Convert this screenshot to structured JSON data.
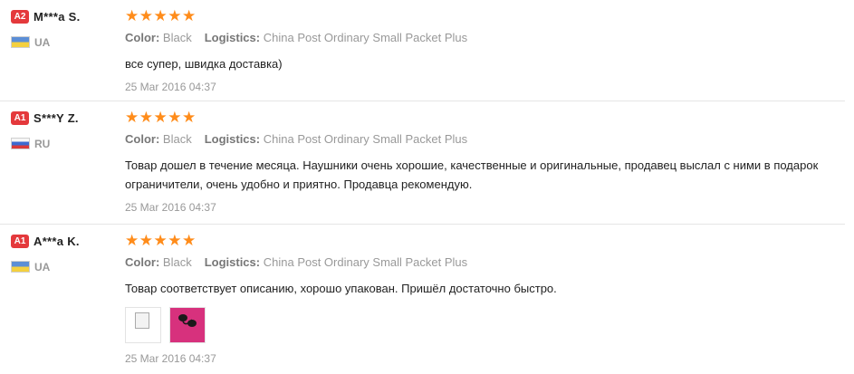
{
  "reviews": [
    {
      "level": "A2",
      "name": "M***a S.",
      "country": "UA",
      "rating": 5,
      "color_label": "Color:",
      "color_value": "Black",
      "logistics_label": "Logistics:",
      "logistics_value": "China Post Ordinary Small Packet Plus",
      "text": "все супер, швидка доставка)",
      "date": "25 Mar 2016 04:37"
    },
    {
      "level": "A1",
      "name": "S***Y Z.",
      "country": "RU",
      "rating": 5,
      "color_label": "Color:",
      "color_value": "Black",
      "logistics_label": "Logistics:",
      "logistics_value": "China Post Ordinary Small Packet Plus",
      "text_line1": "Товар дошел в течение месяца. Наушники очень хорошие, качественные и оригинальные, продавец выслал с ними в подарок",
      "text_line2": "ограничители, очень удобно и приятно. Продавца рекомендую.",
      "date": "25 Mar 2016 04:37"
    },
    {
      "level": "A1",
      "name": "A***a K.",
      "country": "UA",
      "rating": 5,
      "color_label": "Color:",
      "color_value": "Black",
      "logistics_label": "Logistics:",
      "logistics_value": "China Post Ordinary Small Packet Plus",
      "text": "Товар соответствует описанию, хорошо упакован. Пришёл достаточно быстро.",
      "images": [
        "broken-image",
        "earphones-photo"
      ],
      "date": "25 Mar 2016 04:37"
    }
  ],
  "icons": {
    "star": "★",
    "star_color": "#ff8c1a",
    "level_badge_color": "#e4393c"
  }
}
